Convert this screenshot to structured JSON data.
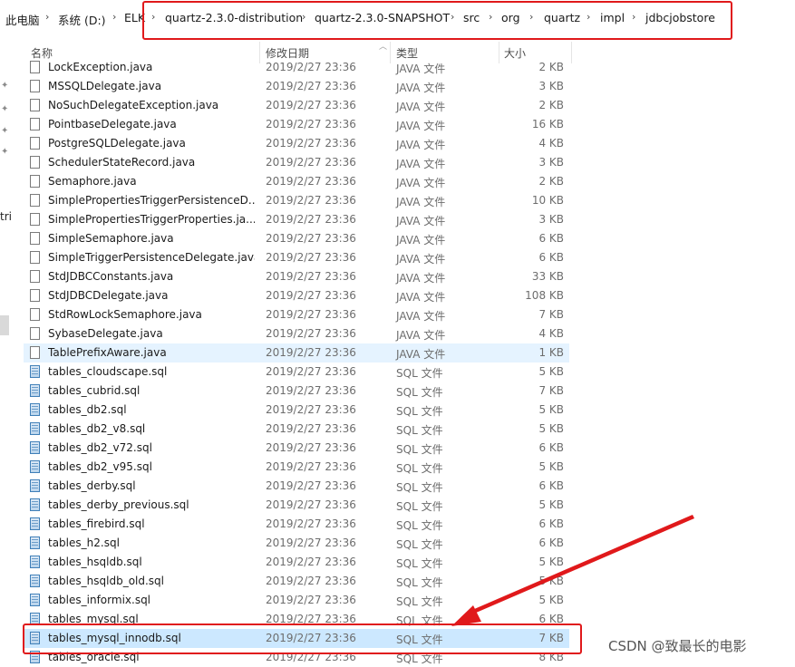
{
  "breadcrumb": {
    "items": [
      "此电脑",
      "系统 (D:)",
      "ELK",
      "quartz-2.3.0-distribution",
      "quartz-2.3.0-SNAPSHOT",
      "src",
      "org",
      "quartz",
      "impl",
      "jdbcjobstore"
    ],
    "separator": "›"
  },
  "nav": {
    "partial_label": "tri"
  },
  "columns": {
    "name": "名称",
    "date": "修改日期",
    "type": "类型",
    "size": "大小"
  },
  "files": [
    {
      "name": "LockException.java",
      "date": "2019/2/27 23:36",
      "type": "JAVA 文件",
      "size": "2 KB",
      "kind": "java"
    },
    {
      "name": "MSSQLDelegate.java",
      "date": "2019/2/27 23:36",
      "type": "JAVA 文件",
      "size": "3 KB",
      "kind": "java"
    },
    {
      "name": "NoSuchDelegateException.java",
      "date": "2019/2/27 23:36",
      "type": "JAVA 文件",
      "size": "2 KB",
      "kind": "java"
    },
    {
      "name": "PointbaseDelegate.java",
      "date": "2019/2/27 23:36",
      "type": "JAVA 文件",
      "size": "16 KB",
      "kind": "java"
    },
    {
      "name": "PostgreSQLDelegate.java",
      "date": "2019/2/27 23:36",
      "type": "JAVA 文件",
      "size": "4 KB",
      "kind": "java"
    },
    {
      "name": "SchedulerStateRecord.java",
      "date": "2019/2/27 23:36",
      "type": "JAVA 文件",
      "size": "3 KB",
      "kind": "java"
    },
    {
      "name": "Semaphore.java",
      "date": "2019/2/27 23:36",
      "type": "JAVA 文件",
      "size": "2 KB",
      "kind": "java"
    },
    {
      "name": "SimplePropertiesTriggerPersistenceD...",
      "date": "2019/2/27 23:36",
      "type": "JAVA 文件",
      "size": "10 KB",
      "kind": "java"
    },
    {
      "name": "SimplePropertiesTriggerProperties.ja...",
      "date": "2019/2/27 23:36",
      "type": "JAVA 文件",
      "size": "3 KB",
      "kind": "java"
    },
    {
      "name": "SimpleSemaphore.java",
      "date": "2019/2/27 23:36",
      "type": "JAVA 文件",
      "size": "6 KB",
      "kind": "java"
    },
    {
      "name": "SimpleTriggerPersistenceDelegate.java",
      "date": "2019/2/27 23:36",
      "type": "JAVA 文件",
      "size": "6 KB",
      "kind": "java"
    },
    {
      "name": "StdJDBCConstants.java",
      "date": "2019/2/27 23:36",
      "type": "JAVA 文件",
      "size": "33 KB",
      "kind": "java"
    },
    {
      "name": "StdJDBCDelegate.java",
      "date": "2019/2/27 23:36",
      "type": "JAVA 文件",
      "size": "108 KB",
      "kind": "java"
    },
    {
      "name": "StdRowLockSemaphore.java",
      "date": "2019/2/27 23:36",
      "type": "JAVA 文件",
      "size": "7 KB",
      "kind": "java"
    },
    {
      "name": "SybaseDelegate.java",
      "date": "2019/2/27 23:36",
      "type": "JAVA 文件",
      "size": "4 KB",
      "kind": "java"
    },
    {
      "name": "TablePrefixAware.java",
      "date": "2019/2/27 23:36",
      "type": "JAVA 文件",
      "size": "1 KB",
      "kind": "java",
      "state": "hover"
    },
    {
      "name": "tables_cloudscape.sql",
      "date": "2019/2/27 23:36",
      "type": "SQL 文件",
      "size": "5 KB",
      "kind": "sql"
    },
    {
      "name": "tables_cubrid.sql",
      "date": "2019/2/27 23:36",
      "type": "SQL 文件",
      "size": "7 KB",
      "kind": "sql"
    },
    {
      "name": "tables_db2.sql",
      "date": "2019/2/27 23:36",
      "type": "SQL 文件",
      "size": "5 KB",
      "kind": "sql"
    },
    {
      "name": "tables_db2_v8.sql",
      "date": "2019/2/27 23:36",
      "type": "SQL 文件",
      "size": "5 KB",
      "kind": "sql"
    },
    {
      "name": "tables_db2_v72.sql",
      "date": "2019/2/27 23:36",
      "type": "SQL 文件",
      "size": "6 KB",
      "kind": "sql"
    },
    {
      "name": "tables_db2_v95.sql",
      "date": "2019/2/27 23:36",
      "type": "SQL 文件",
      "size": "5 KB",
      "kind": "sql"
    },
    {
      "name": "tables_derby.sql",
      "date": "2019/2/27 23:36",
      "type": "SQL 文件",
      "size": "6 KB",
      "kind": "sql"
    },
    {
      "name": "tables_derby_previous.sql",
      "date": "2019/2/27 23:36",
      "type": "SQL 文件",
      "size": "5 KB",
      "kind": "sql"
    },
    {
      "name": "tables_firebird.sql",
      "date": "2019/2/27 23:36",
      "type": "SQL 文件",
      "size": "6 KB",
      "kind": "sql"
    },
    {
      "name": "tables_h2.sql",
      "date": "2019/2/27 23:36",
      "type": "SQL 文件",
      "size": "6 KB",
      "kind": "sql"
    },
    {
      "name": "tables_hsqldb.sql",
      "date": "2019/2/27 23:36",
      "type": "SQL 文件",
      "size": "5 KB",
      "kind": "sql"
    },
    {
      "name": "tables_hsqldb_old.sql",
      "date": "2019/2/27 23:36",
      "type": "SQL 文件",
      "size": "5 KB",
      "kind": "sql"
    },
    {
      "name": "tables_informix.sql",
      "date": "2019/2/27 23:36",
      "type": "SQL 文件",
      "size": "5 KB",
      "kind": "sql"
    },
    {
      "name": "tables_mysql.sql",
      "date": "2019/2/27 23:36",
      "type": "SQL 文件",
      "size": "6 KB",
      "kind": "sql"
    },
    {
      "name": "tables_mysql_innodb.sql",
      "date": "2019/2/27 23:36",
      "type": "SQL 文件",
      "size": "7 KB",
      "kind": "sql",
      "state": "selected"
    },
    {
      "name": "tables_oracle.sql",
      "date": "2019/2/27 23:36",
      "type": "SQL 文件",
      "size": "8 KB",
      "kind": "sql"
    }
  ],
  "watermark": "CSDN @致最长的电影",
  "colors": {
    "annotation_red": "#e0191b",
    "selected_row": "#cce8ff",
    "hover_row": "#e5f3ff"
  }
}
